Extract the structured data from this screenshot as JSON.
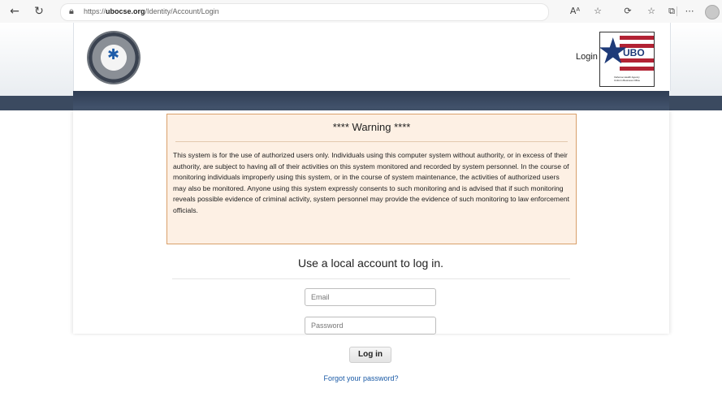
{
  "browser": {
    "url_prefix": "https://",
    "url_domain": "ubocse.org",
    "url_path": "/Identity/Account/Login",
    "back_icon": "arrow-left",
    "refresh_icon": "refresh",
    "lock_icon": "lock"
  },
  "header": {
    "login_link": "Login",
    "ubo_logo_text": "UBO",
    "ubo_caption_line1": "Defense Health Agency",
    "ubo_caption_line2": "Uniform Business Office"
  },
  "warning": {
    "title": "**** Warning ****",
    "body": "This system is for the use of authorized users only. Individuals using this computer system without authority, or in excess of their authority, are subject to having all of their activities on this system monitored and recorded by system personnel. In the course of monitoring individuals improperly using this system, or in the course of system maintenance, the activities of authorized users may also be monitored. Anyone using this system expressly consents to such monitoring and is advised that if such monitoring reveals possible evidence of criminal activity, system personnel may provide the evidence of such monitoring to law enforcement officials."
  },
  "login_form": {
    "title": "Use a local account to log in.",
    "email_placeholder": "Email",
    "email_value": "",
    "password_placeholder": "Password",
    "password_value": "",
    "submit_label": "Log in",
    "forgot_link": "Forgot your password?"
  },
  "colors": {
    "navbar": "#3b4a60",
    "warning_bg": "#fdf0e4",
    "warning_border": "#d9a06b",
    "link": "#1a5aa6"
  }
}
